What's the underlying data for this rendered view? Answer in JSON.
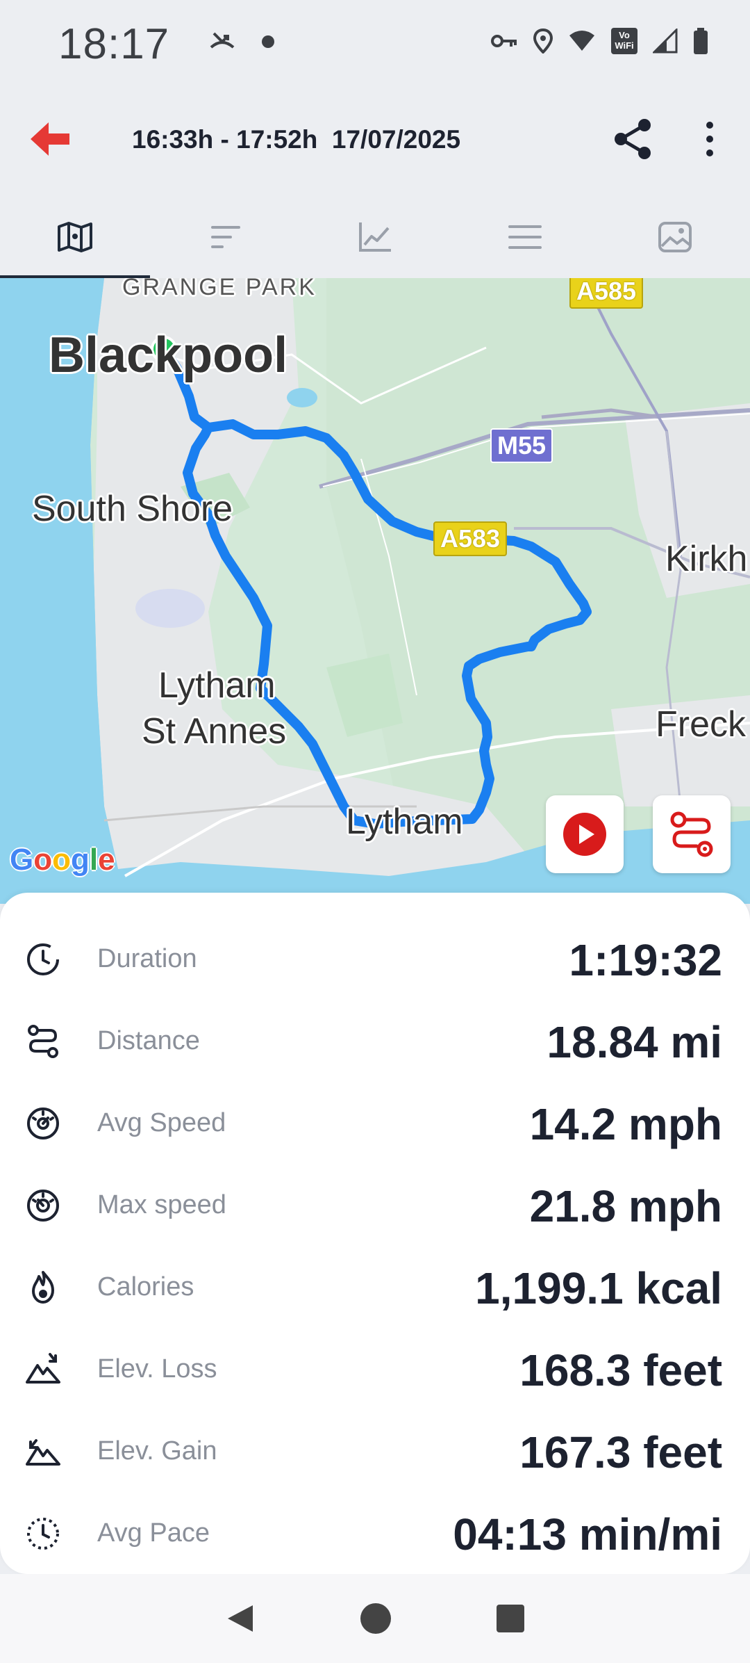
{
  "status_bar": {
    "time": "18:17",
    "left_icons": [
      "missed-call-icon",
      "dot-icon"
    ],
    "right_icons": [
      "vpn-key-icon",
      "location-icon",
      "wifi-icon",
      "vowifi-icon",
      "signal-icon",
      "battery-icon"
    ],
    "vowifi_text": "Vo WiFi"
  },
  "app_bar": {
    "title": "16:33h - 17:52h  17/07/2025",
    "accent_color": "#e53935"
  },
  "tabs": [
    {
      "icon": "map-icon",
      "active": true
    },
    {
      "icon": "laps-icon",
      "active": false
    },
    {
      "icon": "chart-icon",
      "active": false
    },
    {
      "icon": "list-icon",
      "active": false
    },
    {
      "icon": "photo-icon",
      "active": false
    }
  ],
  "map": {
    "labels": {
      "grange_park": "GRANGE PARK",
      "blackpool": "Blackpool",
      "south_shore": "South Shore",
      "lytham_st_annes_1": "Lytham",
      "lytham_st_annes_2": "St Annes",
      "lytham": "Lytham",
      "kirkham": "Kirkh",
      "freckleton": "Freck"
    },
    "road_shields": {
      "a585": "A585",
      "m55": "M55",
      "a583": "A583"
    },
    "google": [
      "G",
      "o",
      "o",
      "g",
      "l",
      "e"
    ],
    "route_color": "#1a73e8",
    "start_marker_color": "#22c55e"
  },
  "stats": [
    {
      "icon": "clock-icon",
      "label": "Duration",
      "value": "1:19:32"
    },
    {
      "icon": "route-icon",
      "label": "Distance",
      "value": "18.84 mi"
    },
    {
      "icon": "speedometer-icon",
      "label": "Avg Speed",
      "value": "14.2 mph"
    },
    {
      "icon": "max-speed-icon",
      "label": "Max speed",
      "value": "21.8 mph"
    },
    {
      "icon": "flame-icon",
      "label": "Calories",
      "value": "1,199.1 kcal"
    },
    {
      "icon": "elevation-loss-icon",
      "label": "Elev. Loss",
      "value": "168.3 feet"
    },
    {
      "icon": "elevation-gain-icon",
      "label": "Elev. Gain",
      "value": "167.3 feet"
    },
    {
      "icon": "pace-icon",
      "label": "Avg Pace",
      "value": "04:13 min/mi"
    }
  ]
}
